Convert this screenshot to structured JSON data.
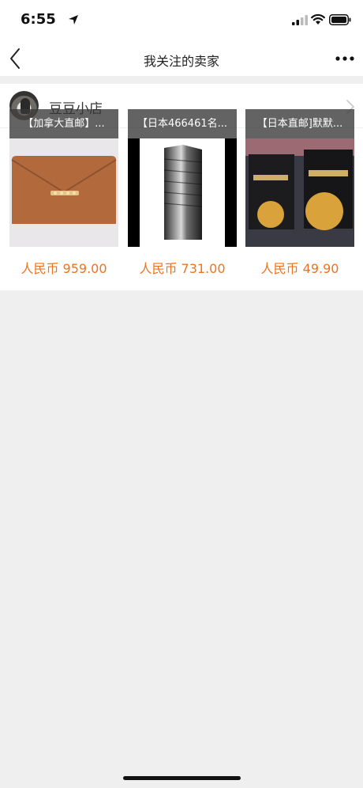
{
  "status_bar": {
    "time": "6:55",
    "icons": [
      "location-arrow-icon",
      "cellular-signal-icon",
      "wifi-icon",
      "battery-icon"
    ]
  },
  "nav": {
    "title": "我关注的卖家",
    "back_icon": "chevron-left-icon",
    "more_icon": "more-dots-icon"
  },
  "shop": {
    "name": "豆豆小店",
    "avatar_icon": "avatar",
    "chevron_icon": "chevron-right-icon"
  },
  "products": [
    {
      "title": "【加拿大直邮】...",
      "price": "人民币 959.00"
    },
    {
      "title": "【日本466461名...",
      "price": "人民币 731.00"
    },
    {
      "title": "【日本直邮]默默...",
      "price": "人民币 49.90"
    }
  ],
  "colors": {
    "price": "#f0731d",
    "background": "#efefef",
    "card": "#ffffff"
  }
}
